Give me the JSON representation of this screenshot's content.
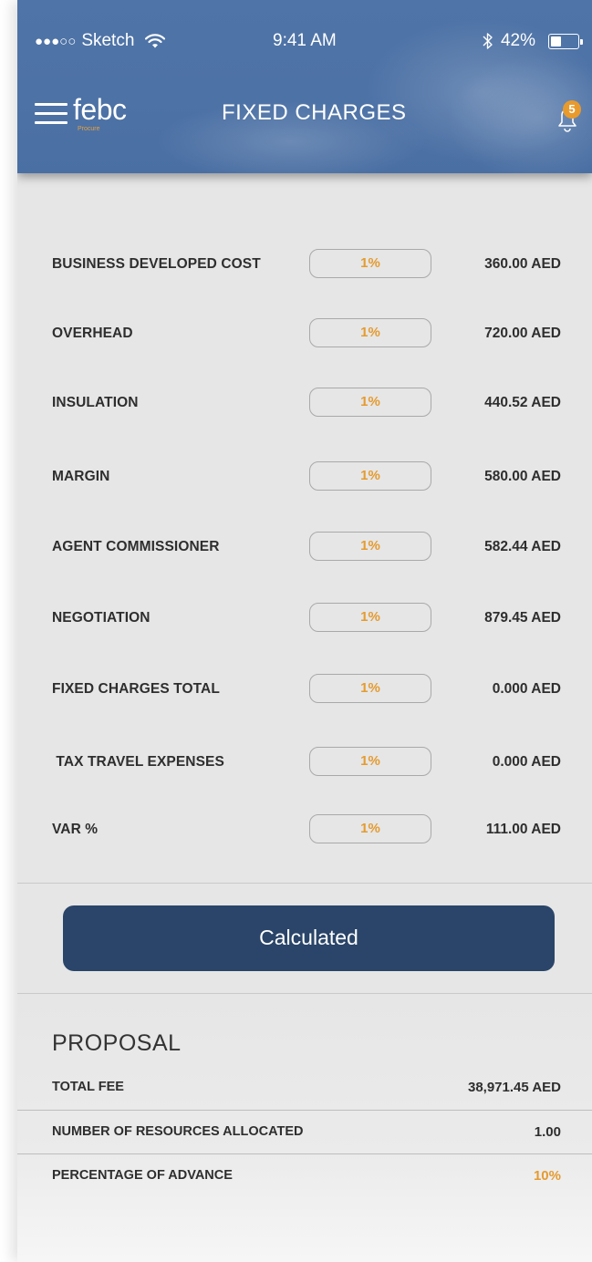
{
  "status_bar": {
    "signal": "●●●○○",
    "carrier": "Sketch",
    "time": "9:41 AM",
    "battery": "42%",
    "battery_level": 0.42
  },
  "navbar": {
    "logo": "febc",
    "logo_sub": "Procure",
    "title": "FIXED CHARGES",
    "notification_count": "5"
  },
  "charges": [
    {
      "label": "BUSINESS DEVELOPED COST",
      "percent": "1%",
      "amount": "360.00 AED"
    },
    {
      "label": "OVERHEAD",
      "percent": "1%",
      "amount": "720.00 AED"
    },
    {
      "label": "INSULATION",
      "percent": "1%",
      "amount": "440.52 AED"
    },
    {
      "label": "MARGIN",
      "percent": "1%",
      "amount": "580.00 AED"
    },
    {
      "label": "AGENT COMMISSIONER",
      "percent": "1%",
      "amount": "582.44 AED"
    },
    {
      "label": "NEGOTIATION",
      "percent": "1%",
      "amount": "879.45 AED"
    },
    {
      "label": "FIXED CHARGES TOTAL",
      "percent": "1%",
      "amount": "0.000 AED"
    },
    {
      "label": " TAX TRAVEL EXPENSES",
      "percent": "1%",
      "amount": "0.000 AED"
    },
    {
      "label": "VAR %",
      "percent": "1%",
      "amount": "111.00 AED"
    }
  ],
  "calculate_button": "Calculated",
  "proposal": {
    "title": "PROPOSAL",
    "rows": [
      {
        "label": "TOTAL FEE",
        "value": "38,971.45 AED"
      },
      {
        "label": "NUMBER OF RESOURCES ALLOCATED",
        "value": "1.00"
      },
      {
        "label": "PERCENTAGE OF ADVANCE",
        "value": "10%"
      }
    ]
  },
  "colors": {
    "header": "#4d72a6",
    "accent": "#e59b2f",
    "button": "#2a4569",
    "background": "#e6e6e6"
  }
}
